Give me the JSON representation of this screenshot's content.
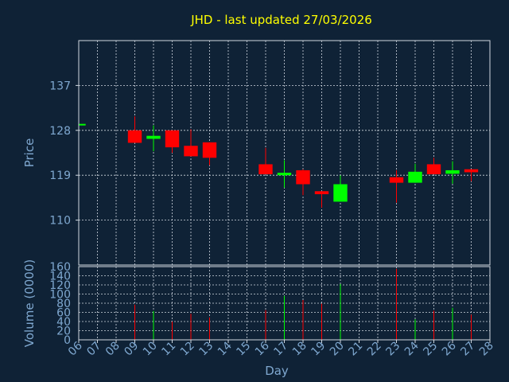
{
  "chart_data": {
    "type": "candlestick",
    "title": "JHD - last updated 27/03/2026",
    "xlabel": "Day",
    "ylabel_price": "Price",
    "ylabel_volume": "Volume (0000)",
    "x_ticks": [
      "06",
      "07",
      "08",
      "09",
      "10",
      "11",
      "12",
      "13",
      "14",
      "15",
      "16",
      "17",
      "18",
      "19",
      "20",
      "21",
      "22",
      "23",
      "24",
      "25",
      "26",
      "27",
      "28"
    ],
    "price_ticks": [
      110,
      119,
      128,
      137
    ],
    "price_range": [
      101,
      146
    ],
    "volume_ticks": [
      0,
      20,
      40,
      60,
      80,
      100,
      120,
      140,
      160
    ],
    "volume_range": [
      0,
      160
    ],
    "up_color": "#00ff00",
    "down_color": "#ff0000",
    "background": "#0f2236",
    "grid": true,
    "candles": [
      {
        "day": "06",
        "open": 129.0,
        "close": 129.3,
        "high": 129.3,
        "low": 129.0,
        "volume": 0
      },
      {
        "day": "09",
        "open": 128.0,
        "close": 125.5,
        "high": 130.8,
        "low": 125.5,
        "volume": 77
      },
      {
        "day": "10",
        "open": 126.3,
        "close": 126.9,
        "high": 129.0,
        "low": 123.8,
        "volume": 63
      },
      {
        "day": "11",
        "open": 128.0,
        "close": 124.6,
        "high": 128.0,
        "low": 123.5,
        "volume": 40
      },
      {
        "day": "12",
        "open": 124.9,
        "close": 122.8,
        "high": 128.2,
        "low": 122.8,
        "volume": 57
      },
      {
        "day": "13",
        "open": 125.6,
        "close": 122.5,
        "high": 125.6,
        "low": 121.0,
        "volume": 49
      },
      {
        "day": "16",
        "open": 121.2,
        "close": 119.2,
        "high": 124.5,
        "low": 119.2,
        "volume": 65
      },
      {
        "day": "17",
        "open": 119.0,
        "close": 119.5,
        "high": 122.0,
        "low": 116.5,
        "volume": 96
      },
      {
        "day": "18",
        "open": 120.0,
        "close": 117.2,
        "high": 120.2,
        "low": 115.0,
        "volume": 87
      },
      {
        "day": "19",
        "open": 115.8,
        "close": 115.2,
        "high": 115.8,
        "low": 112.5,
        "volume": 79
      },
      {
        "day": "20",
        "open": 113.7,
        "close": 117.2,
        "high": 119.0,
        "low": 113.7,
        "volume": 122
      },
      {
        "day": "23",
        "open": 118.6,
        "close": 117.5,
        "high": 120.0,
        "low": 113.5,
        "volume": 155
      },
      {
        "day": "24",
        "open": 117.5,
        "close": 119.7,
        "high": 121.3,
        "low": 117.5,
        "volume": 45
      },
      {
        "day": "25",
        "open": 121.2,
        "close": 119.2,
        "high": 122.5,
        "low": 119.2,
        "volume": 64
      },
      {
        "day": "26",
        "open": 119.3,
        "close": 120.0,
        "high": 121.8,
        "low": 117.3,
        "volume": 70
      },
      {
        "day": "27",
        "open": 120.2,
        "close": 119.6,
        "high": 120.2,
        "low": 117.8,
        "volume": 55
      }
    ]
  }
}
